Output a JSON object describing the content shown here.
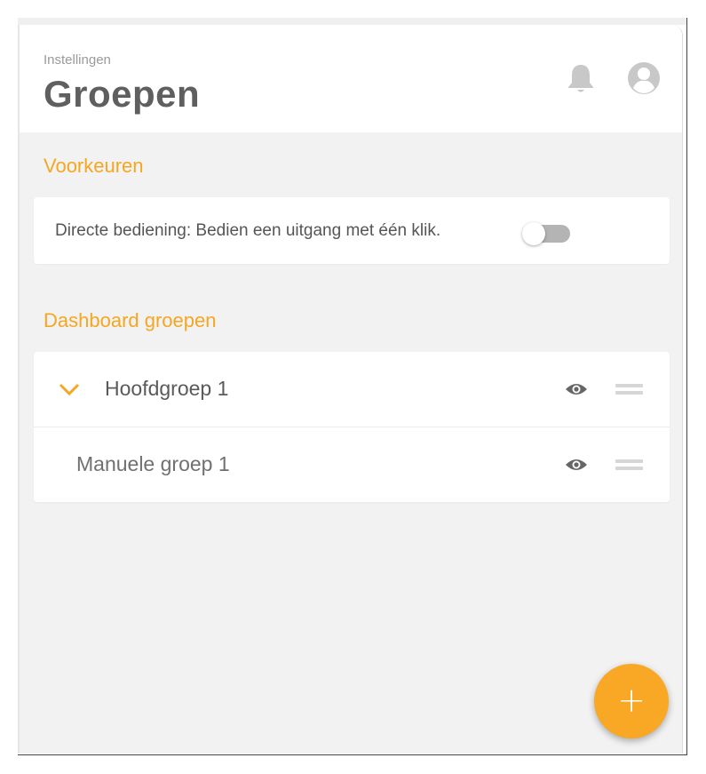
{
  "header": {
    "breadcrumb": "Instellingen",
    "title": "Groepen",
    "icons": [
      "bell-icon",
      "account-icon"
    ]
  },
  "preferences": {
    "section_title": "Voorkeuren",
    "direct_control_label": "Directe bediening: Bedien een uitgang met één klik.",
    "direct_control_enabled": false
  },
  "dashboard_groups": {
    "section_title": "Dashboard groepen",
    "groups": [
      {
        "name": "Hoofdgroep 1",
        "expanded": true,
        "visible": true
      },
      {
        "name": "Manuele groep 1",
        "visible": true
      }
    ]
  },
  "fab": {
    "label": "+"
  },
  "colors": {
    "accent": "#f5a623",
    "fab": "#f9a825",
    "title": "#5f5f5f",
    "background": "#f2f2f2"
  }
}
